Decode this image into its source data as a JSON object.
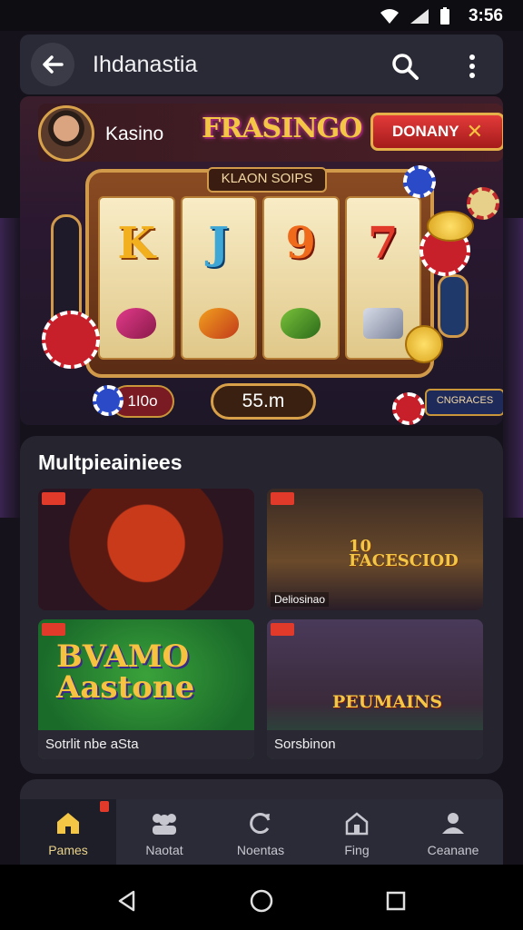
{
  "status": {
    "time": "3:56"
  },
  "appbar": {
    "title": "Ihdanastia"
  },
  "hero": {
    "label": "Kasino",
    "logo_text": "FRASINGO",
    "button_label": "DONANY",
    "button_icon": "close-icon",
    "machine_header": "KLAON SOIPS",
    "reel_symbols": [
      "K",
      "J",
      "9",
      "7"
    ],
    "bet_value": "1I0o",
    "win_value": "55.m",
    "promo_text": "CNGRACES"
  },
  "games": {
    "title": "Multpieainiees",
    "cards": [
      {
        "caption": "",
        "overlay": ""
      },
      {
        "caption": "",
        "overlay": "10\nFACESCIOD",
        "small": "Deliosinao"
      },
      {
        "caption": "Sotrlit nbe aSta",
        "overlay": "BVAMO\nAastone"
      },
      {
        "caption": "Sorsbinon",
        "overlay": "PEUMAINS"
      }
    ]
  },
  "nav": {
    "items": [
      {
        "label": "Pames",
        "icon": "home-icon",
        "active": true
      },
      {
        "label": "Naotat",
        "icon": "group-icon"
      },
      {
        "label": "Noentas",
        "icon": "refresh-icon"
      },
      {
        "label": "Fing",
        "icon": "house-icon"
      },
      {
        "label": "Ceanane",
        "icon": "profile-icon"
      }
    ]
  },
  "colors": {
    "accent": "#e9d38a",
    "card": "#26252f",
    "appbar": "#2a2a36",
    "danger": "#e23a2a"
  }
}
